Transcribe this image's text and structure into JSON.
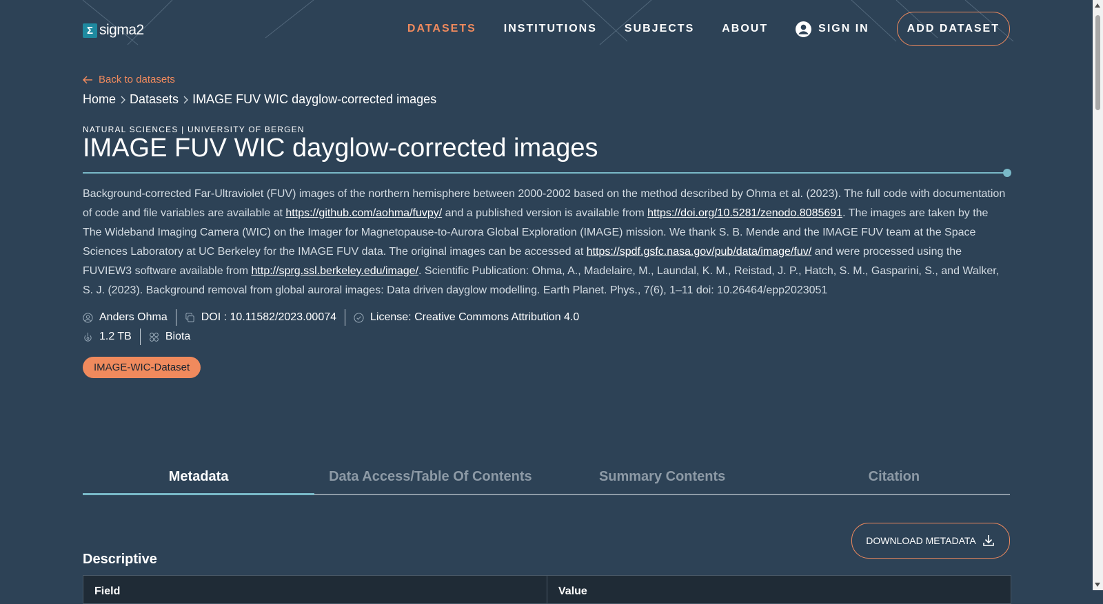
{
  "logo": {
    "mark": "Σ",
    "text": "sigma2"
  },
  "nav": {
    "datasets": "DATASETS",
    "institutions": "INSTITUTIONS",
    "subjects": "SUBJECTS",
    "about": "ABOUT",
    "sign_in": "SIGN IN",
    "add_dataset": "ADD DATASET"
  },
  "back_link": "Back to datasets",
  "breadcrumb": {
    "home": "Home",
    "datasets": "Datasets",
    "current": "IMAGE FUV WIC dayglow-corrected images"
  },
  "dataset": {
    "kicker": "NATURAL SCIENCES | UNIVERSITY OF BERGEN",
    "title": "IMAGE FUV WIC dayglow-corrected images",
    "desc": {
      "p1": "Background-corrected Far-Ultraviolet (FUV) images of the northern hemisphere between 2000-2002 based on the method described by Ohma et al. (2023). The full code with documentation of code and file variables are available at ",
      "link1": "https://github.com/aohma/fuvpy/",
      "p2": " and a published version is available from ",
      "link2": "https://doi.org/10.5281/zenodo.8085691",
      "p3": ". The images are taken by the The Wideband Imaging Camera (WIC) on the Imager for Magnetopause-to-Aurora Global Exploration (IMAGE) mission. We thank S. B. Mende and the IMAGE FUV team at the Space Sciences Laboratory at UC Berkeley for the IMAGE FUV data. The original images can be accessed at ",
      "link3": "https://spdf.gsfc.nasa.gov/pub/data/image/fuv/",
      "p4": " and were processed using the FUVIEW3 software available from ",
      "link4": "http://sprg.ssl.berkeley.edu/image/",
      "p5": ". Scientific Publication: Ohma, A., Madelaire, M., Laundal, K. M., Reistad, J. P., Hatch, S. M., Gasparini, S., and Walker, S. J. (2023). Background removal from global auroral images: Data driven dayglow modelling. Earth Planet. Phys., 7(6), 1–11 doi: 10.26464/epp2023051"
    },
    "author": "Anders Ohma",
    "doi": "DOI : 10.11582/2023.00074",
    "license": "License: Creative Commons Attribution 4.0",
    "size": "1.2 TB",
    "category": "Biota",
    "tag": "IMAGE-WIC-Dataset"
  },
  "tabs": {
    "metadata": "Metadata",
    "data_access": "Data Access/Table Of Contents",
    "summary": "Summary Contents",
    "citation": "Citation"
  },
  "download_metadata": "DOWNLOAD METADATA",
  "section_descriptive": "Descriptive",
  "table": {
    "col_field": "Field",
    "col_value": "Value"
  },
  "colors": {
    "background": "#2d4256",
    "accent": "#f08a5d",
    "rule": "#79b9c8"
  }
}
